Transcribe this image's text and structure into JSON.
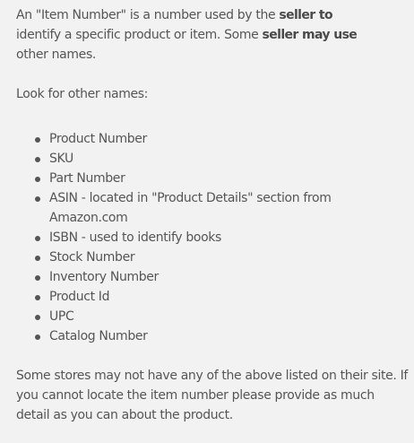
{
  "intro": {
    "text_1": "An \"Item Number\" is a number used by the ",
    "bold_1": "seller to",
    "text_2": "identify a specific product or item. Some ",
    "bold_2": "seller may use",
    "text_3": "other names."
  },
  "look_for": "Look for other names:",
  "names": [
    "Product Number",
    "SKU",
    "Part Number",
    "ASIN - located in \"Product Details\" section from Amazon.com",
    "ISBN - used to identify books",
    "Stock Number",
    "Inventory Number",
    "Product Id",
    "UPC",
    "Catalog Number"
  ],
  "footer": "Some stores may not have any of the above listed on their site. If you cannot locate the item number please provide as much detail as you can about the product."
}
